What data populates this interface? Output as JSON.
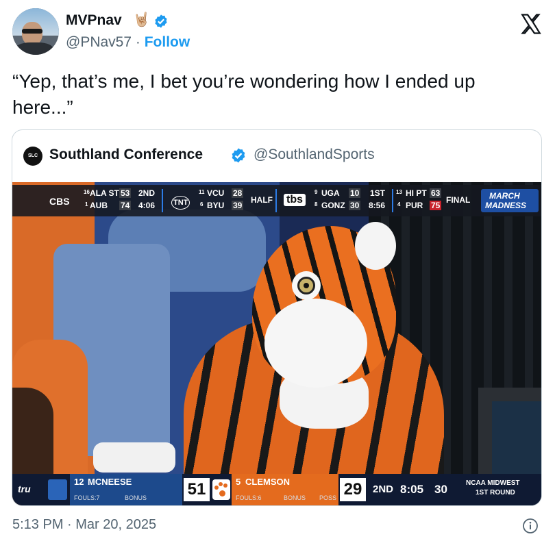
{
  "tweet": {
    "display_name": "MVPnav",
    "name_emoji": "🤘🏼",
    "handle": "@PNav57",
    "separator": "·",
    "follow_label": "Follow",
    "text": "“Yep, that’s me, I bet you’re wondering how I ended up here...”",
    "timestamp": "5:13 PM · Mar 20, 2025"
  },
  "quote": {
    "logo_text": "SLC",
    "display_name": "Southland Conference",
    "handle": "@SouthlandSports"
  },
  "ticker": {
    "network1": "CBS",
    "game1": {
      "seed_a": "16",
      "team_a": "ALA ST",
      "score_a": "53",
      "seed_b": "1",
      "team_b": "AUB",
      "score_b": "74",
      "period": "2ND",
      "clock": "4:06"
    },
    "network2": "TNT",
    "game2": {
      "seed_a": "11",
      "team_a": "VCU",
      "score_a": "28",
      "seed_b": "6",
      "team_b": "BYU",
      "score_b": "39",
      "status": "HALF"
    },
    "network3": "tbs",
    "game3": {
      "seed_a": "9",
      "team_a": "UGA",
      "score_a": "10",
      "seed_b": "8",
      "team_b": "GONZ",
      "score_b": "30",
      "period": "1ST",
      "clock": "8:56"
    },
    "game4": {
      "seed_a": "13",
      "team_a": "HI PT",
      "score_a": "63",
      "seed_b": "4",
      "team_b": "PUR",
      "score_b": "75",
      "status": "FINAL"
    },
    "brand_line1": "MARCH",
    "brand_line2": "MADNESS"
  },
  "scorebug": {
    "sponsor": "tru",
    "team1": {
      "seed": "12",
      "name": "MCNEESE",
      "fouls": "FOULS:7",
      "bonus": "BONUS",
      "score": "51"
    },
    "team2": {
      "seed": "5",
      "name": "CLEMSON",
      "fouls": "FOULS:6",
      "bonus": "BONUS",
      "poss": "POSS",
      "score": "29"
    },
    "period": "2ND",
    "clock": "8:05",
    "shot_clock": "30",
    "region_line1": "NCAA MIDWEST",
    "region_line2": "1ST ROUND"
  },
  "colors": {
    "accent": "#1d9bf0",
    "verified": "#1d9bf0",
    "muted": "#536471",
    "border": "#cfd9de"
  },
  "icons": {
    "verified": "verified-badge-icon",
    "x_logo": "x-logo-icon",
    "info": "info-icon"
  }
}
